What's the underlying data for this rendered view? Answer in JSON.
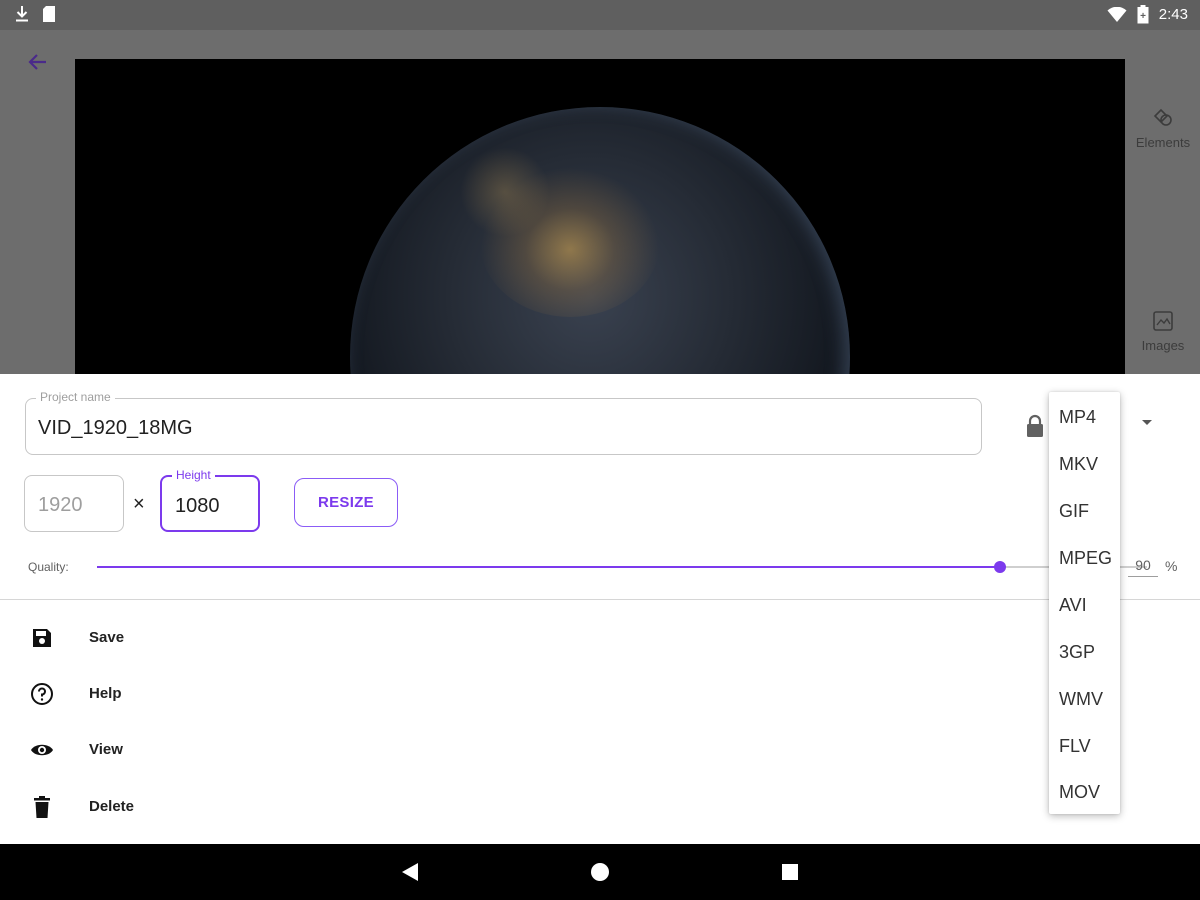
{
  "status_bar": {
    "time": "2:43",
    "left_icons": [
      "download-icon",
      "sd-card-icon"
    ],
    "right_icons": [
      "wifi-icon",
      "battery-icon"
    ]
  },
  "editor": {
    "rail": [
      {
        "label": "Elements",
        "icon": "elements-icon"
      },
      {
        "label": "Images",
        "icon": "images-icon"
      }
    ]
  },
  "project": {
    "name_label": "Project name",
    "name_value": "VID_1920_18MG"
  },
  "resolution": {
    "width_value": "1920",
    "times_symbol": "×",
    "height_label": "Height",
    "height_value": "1080",
    "resize_label": "RESIZE"
  },
  "quality": {
    "label": "Quality:",
    "value": "90",
    "percent_symbol": "%",
    "slider_fraction": 0.86
  },
  "actions": [
    {
      "label": "Save",
      "icon": "save-icon"
    },
    {
      "label": "Help",
      "icon": "help-icon"
    },
    {
      "label": "View",
      "icon": "eye-icon"
    },
    {
      "label": "Delete",
      "icon": "delete-icon"
    }
  ],
  "format_menu": {
    "options": [
      "MP4",
      "MKV",
      "GIF",
      "MPEG",
      "AVI",
      "3GP",
      "WMV",
      "FLV",
      "MOV"
    ]
  },
  "colors": {
    "accent": "#7c3aed",
    "status_bar": "#5f5f5f",
    "dim_overlay": "#6d6d6d",
    "nav_bar": "#000000"
  }
}
